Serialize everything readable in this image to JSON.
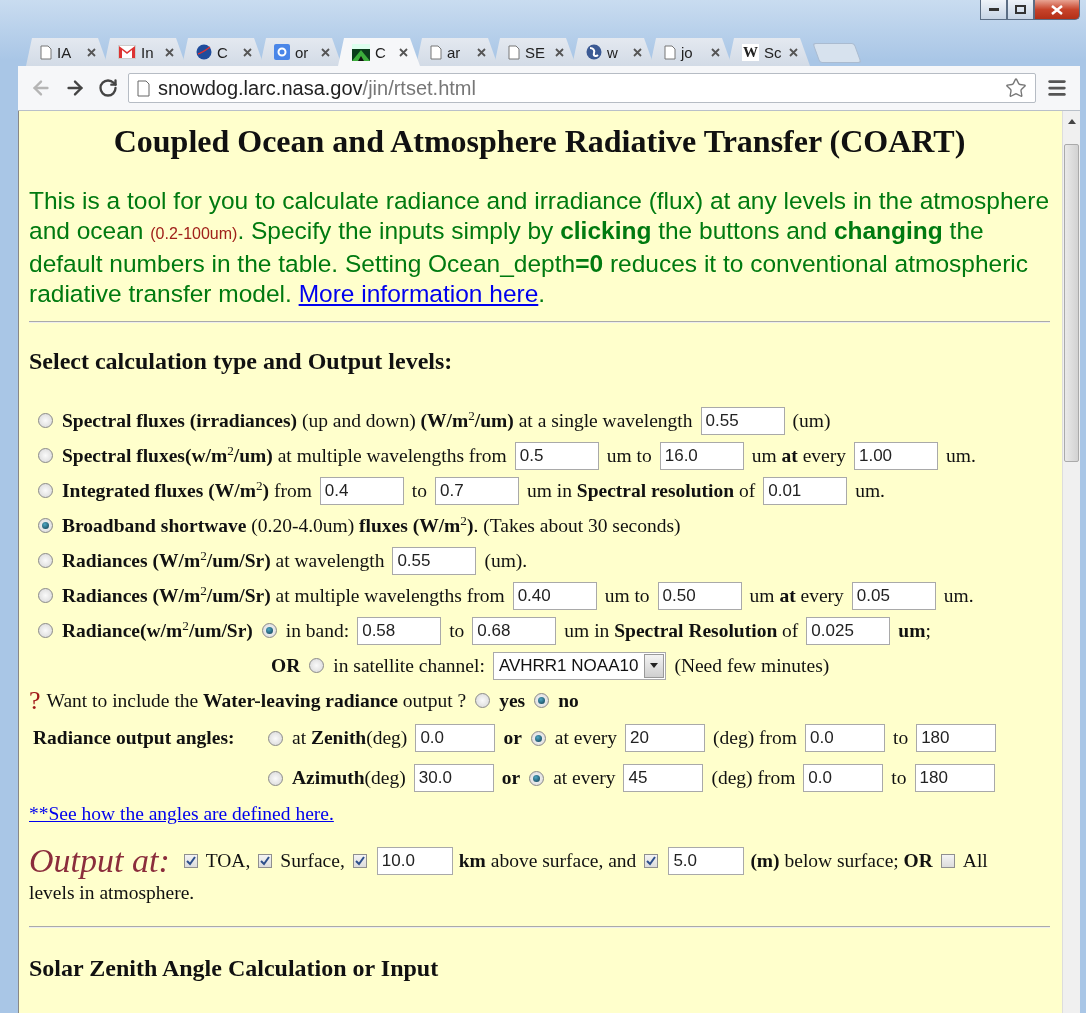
{
  "tabs": [
    {
      "title": "IA",
      "kind": "doc",
      "selected": false
    },
    {
      "title": "In",
      "kind": "mail",
      "selected": false
    },
    {
      "title": "C",
      "kind": "disc",
      "selected": false
    },
    {
      "title": "or",
      "kind": "square",
      "selected": false
    },
    {
      "title": "C",
      "kind": "mountain",
      "selected": true
    },
    {
      "title": "ar",
      "kind": "doc",
      "selected": false
    },
    {
      "title": "SE",
      "kind": "doc",
      "selected": false
    },
    {
      "title": "w",
      "kind": "globe",
      "selected": false
    },
    {
      "title": "jo",
      "kind": "doc",
      "selected": false
    },
    {
      "title": "Sc",
      "kind": "letter",
      "glyph": "W",
      "selected": false
    }
  ],
  "toolbar": {
    "back_disabled": true,
    "forward_disabled": false
  },
  "address": {
    "host": "snowdog.larc.nasa.gov",
    "path": "/jin/rtset.html"
  },
  "page": {
    "title": "Coupled Ocean and Atmosphere Radiative Transfer (COART)",
    "intro": [
      {
        "kind": "text",
        "text": "This is a tool for you to calculate radiance and irradiance (flux) at any levels in the atmosphere and ocean "
      },
      {
        "kind": "note",
        "text": "(0.2-100um)"
      },
      {
        "kind": "text",
        "text": ". Specify the inputs simply by **clicking** the buttons and **changing** the default numbers in the table. Setting Ocean_depth**=0** reduces it to conventional atmospheric radiative transfer model. "
      },
      {
        "kind": "link",
        "text": "More information here"
      },
      {
        "kind": "text",
        "text": "."
      }
    ],
    "section_heading": "Select calculation type and Output levels:",
    "form": [
      {
        "kind": "option",
        "parts": [
          {
            "kind": "radio",
            "selected": false
          },
          {
            "kind": "text",
            "text": "**Spectral fluxes (irradiances)** (up and down) **(W/m**$^{2}$**/um)** at a single wavelength"
          },
          {
            "kind": "input",
            "value": "0.55"
          },
          {
            "kind": "text",
            "text": "(um)"
          }
        ]
      },
      {
        "kind": "option",
        "parts": [
          {
            "kind": "radio",
            "selected": false
          },
          {
            "kind": "text",
            "text": "**Spectral fluxes(w/m**$^{2}$**/um)** at multiple wavelengths from"
          },
          {
            "kind": "input",
            "value": "0.5"
          },
          {
            "kind": "text",
            "text": "um to"
          },
          {
            "kind": "input",
            "value": "16.0"
          },
          {
            "kind": "text",
            "text": "um **at** every"
          },
          {
            "kind": "input",
            "value": "1.00"
          },
          {
            "kind": "text",
            "text": "um."
          }
        ]
      },
      {
        "kind": "option",
        "parts": [
          {
            "kind": "radio",
            "selected": false
          },
          {
            "kind": "text",
            "text": "**Integrated fluxes (W/m**$^{2}$**)** from"
          },
          {
            "kind": "input",
            "value": "0.4"
          },
          {
            "kind": "text",
            "text": "to"
          },
          {
            "kind": "input",
            "value": "0.7"
          },
          {
            "kind": "text",
            "text": "um in **Spectral resolution** of"
          },
          {
            "kind": "input",
            "value": "0.01"
          },
          {
            "kind": "text",
            "text": "um."
          }
        ]
      },
      {
        "kind": "option",
        "parts": [
          {
            "kind": "radio",
            "selected": true
          },
          {
            "kind": "text",
            "text": "**Broadband shortwave** (0.20-4.0um) **fluxes (W/m**$^{2}$**)**. (Takes about 30 seconds)"
          }
        ]
      },
      {
        "kind": "option",
        "parts": [
          {
            "kind": "radio",
            "selected": false
          },
          {
            "kind": "text",
            "text": "**Radiances (W/m**$^{2}$**/um/Sr)** at wavelength"
          },
          {
            "kind": "input",
            "value": "0.55"
          },
          {
            "kind": "text",
            "text": "(um)."
          }
        ]
      },
      {
        "kind": "option",
        "parts": [
          {
            "kind": "radio",
            "selected": false
          },
          {
            "kind": "text",
            "text": "**Radiances (W/m**$^{2}$**/um/Sr)** at multiple wavelengths from"
          },
          {
            "kind": "input",
            "value": "0.40"
          },
          {
            "kind": "text",
            "text": "um to"
          },
          {
            "kind": "input",
            "value": "0.50"
          },
          {
            "kind": "text",
            "text": "um **at** every"
          },
          {
            "kind": "input",
            "value": "0.05"
          },
          {
            "kind": "text",
            "text": "um."
          }
        ]
      },
      {
        "kind": "option",
        "parts": [
          {
            "kind": "radio",
            "selected": false
          },
          {
            "kind": "text",
            "text": "**Radiance(w/m**$^{2}$**/um/Sr)**"
          },
          {
            "kind": "radio",
            "selected": true
          },
          {
            "kind": "text",
            "text": "in band:"
          },
          {
            "kind": "input",
            "value": "0.58"
          },
          {
            "kind": "text",
            "text": "to"
          },
          {
            "kind": "input",
            "value": "0.68"
          },
          {
            "kind": "text",
            "text": "um in **Spectral Resolution** of"
          },
          {
            "kind": "input",
            "value": "0.025"
          },
          {
            "kind": "text",
            "text": "**um**;"
          }
        ]
      },
      {
        "kind": "or",
        "parts": [
          {
            "kind": "bold",
            "text": "OR"
          },
          {
            "kind": "radio",
            "selected": false
          },
          {
            "kind": "text",
            "text": "in satellite channel:"
          },
          {
            "kind": "select",
            "value": "AVHRR1 NOAA10"
          },
          {
            "kind": "text",
            "text": "(Need few minutes)"
          }
        ]
      },
      {
        "kind": "question",
        "parts": [
          {
            "kind": "mark",
            "text": "?"
          },
          {
            "kind": "text",
            "text": "Want to include the **Water-leaving radiance** output ?"
          },
          {
            "kind": "radio",
            "selected": false
          },
          {
            "kind": "bold",
            "text": "yes"
          },
          {
            "kind": "radio",
            "selected": true
          },
          {
            "kind": "bold",
            "text": "no"
          }
        ]
      },
      {
        "kind": "angles",
        "parts": [
          {
            "kind": "label",
            "text": "Radiance output angles:"
          },
          {
            "kind": "radio",
            "selected": false
          },
          {
            "kind": "text",
            "text": "at **Zenith**(deg)"
          },
          {
            "kind": "input",
            "value": "0.0"
          },
          {
            "kind": "bold",
            "text": "or"
          },
          {
            "kind": "radio",
            "selected": true
          },
          {
            "kind": "text",
            "text": "at every"
          },
          {
            "kind": "input",
            "value": "20"
          },
          {
            "kind": "text",
            "text": "(deg) from"
          },
          {
            "kind": "input",
            "value": "0.0"
          },
          {
            "kind": "text",
            "text": "to"
          },
          {
            "kind": "input",
            "value": "180"
          }
        ]
      },
      {
        "kind": "angles",
        "parts": [
          {
            "kind": "radio",
            "selected": false
          },
          {
            "kind": "text",
            "text": "**Azimuth**(deg)"
          },
          {
            "kind": "input",
            "value": "30.0"
          },
          {
            "kind": "bold",
            "text": "or"
          },
          {
            "kind": "radio",
            "selected": true
          },
          {
            "kind": "text",
            "text": "at every"
          },
          {
            "kind": "input",
            "value": "45"
          },
          {
            "kind": "text",
            "text": "(deg) from"
          },
          {
            "kind": "input",
            "value": "0.0"
          },
          {
            "kind": "text",
            "text": "to"
          },
          {
            "kind": "input",
            "value": "180"
          }
        ]
      },
      {
        "kind": "link",
        "parts": [
          {
            "kind": "link",
            "text": "**See how the angles are defined here."
          }
        ]
      },
      {
        "kind": "output",
        "parts": [
          {
            "kind": "big",
            "text": "Output at:"
          },
          {
            "kind": "check",
            "checked": true
          },
          {
            "kind": "text",
            "text": "TOA,"
          },
          {
            "kind": "check",
            "checked": true
          },
          {
            "kind": "text",
            "text": "Surface,"
          },
          {
            "kind": "check",
            "checked": true
          },
          {
            "kind": "input",
            "value": "10.0"
          },
          {
            "kind": "text",
            "text": "**km** above surface, and"
          },
          {
            "kind": "check",
            "checked": true
          },
          {
            "kind": "input",
            "value": "5.0"
          },
          {
            "kind": "text",
            "text": "**(m)** below surface; **OR**"
          },
          {
            "kind": "check",
            "checked": false
          },
          {
            "kind": "text",
            "text": "All"
          }
        ]
      },
      {
        "kind": "continued",
        "parts": [
          {
            "kind": "text",
            "text": "levels in atmosphere."
          }
        ]
      }
    ],
    "next_heading": "Solar Zenith Angle Calculation or Input"
  }
}
